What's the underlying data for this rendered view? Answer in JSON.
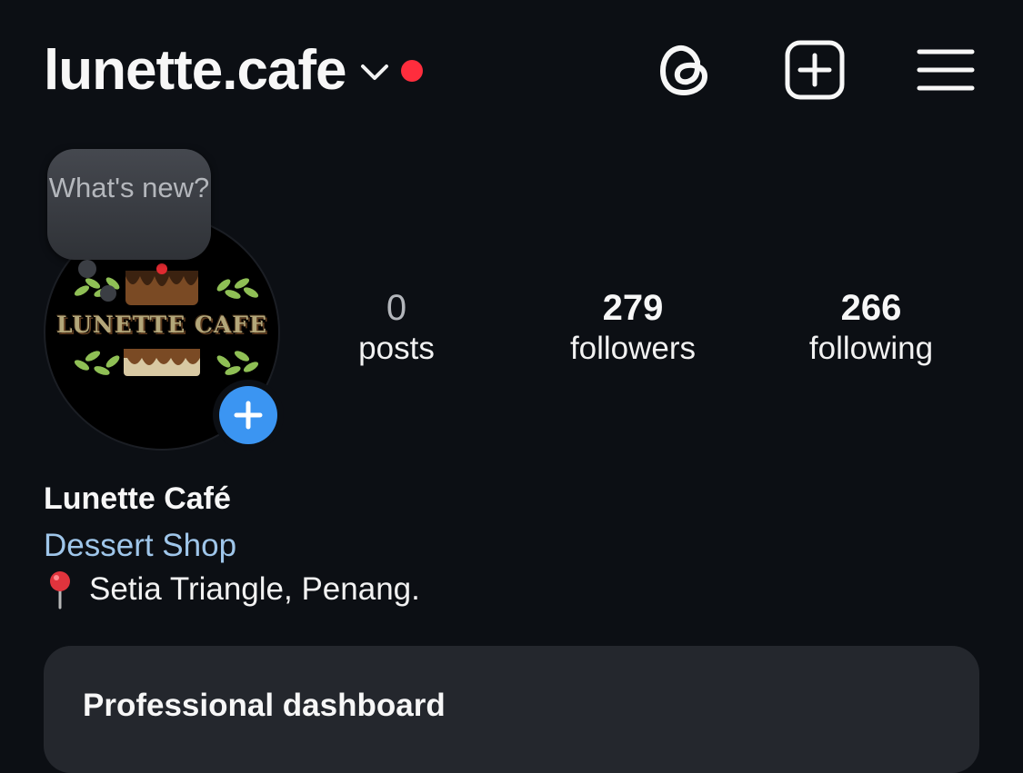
{
  "header": {
    "username": "lunette.cafe",
    "icons": [
      "chevron-down-icon",
      "threads-icon",
      "create-icon",
      "menu-icon"
    ],
    "notification_color": "#ff2d3d"
  },
  "avatar": {
    "logo_text": "LUNETTE CAFE",
    "story_bubble": "What's new?",
    "add_story_icon": "plus-icon",
    "accent": "#3b95f2"
  },
  "stats": [
    {
      "value": "0",
      "label": "posts"
    },
    {
      "value": "279",
      "label": "followers"
    },
    {
      "value": "266",
      "label": "following"
    }
  ],
  "bio": {
    "display_name": "Lunette Café",
    "category": "Dessert Shop",
    "location": "Setia Triangle, Penang.",
    "location_icon": "pin-icon"
  },
  "dashboard": {
    "title": "Professional dashboard"
  },
  "colors": {
    "background": "#0c0f14",
    "card": "#24272d",
    "link": "#9fc6ea"
  }
}
